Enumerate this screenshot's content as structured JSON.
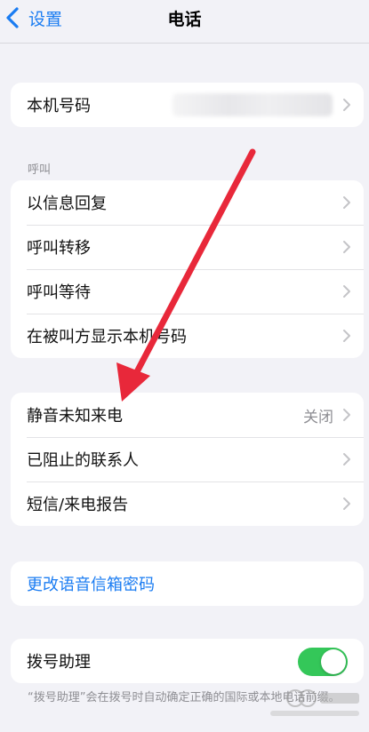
{
  "nav": {
    "back_label": "设置",
    "title": "电话"
  },
  "my_number": {
    "label": "本机号码"
  },
  "calls_section": {
    "header": "呼叫",
    "items": [
      {
        "label": "以信息回复"
      },
      {
        "label": "呼叫转移"
      },
      {
        "label": "呼叫等待"
      },
      {
        "label": "在被叫方显示本机号码"
      }
    ]
  },
  "silence_section": {
    "items": [
      {
        "label": "静音未知来电",
        "value": "关闭"
      },
      {
        "label": "已阻止的联系人"
      },
      {
        "label": "短信/来电报告"
      }
    ]
  },
  "voicemail": {
    "label": "更改语音信箱密码"
  },
  "dial_assist": {
    "label": "拨号助理",
    "enabled": true,
    "footer": "“拨号助理”会在拨号时自动确定正确的国际或本地电话前缀。"
  },
  "colors": {
    "accent_blue": "#1a7cf2",
    "toggle_green": "#34c759",
    "annotation_red": "#e8283a",
    "background": "#f2f2f7"
  },
  "icons": {
    "back": "chevron-left-icon",
    "disclosure": "chevron-right-icon"
  }
}
